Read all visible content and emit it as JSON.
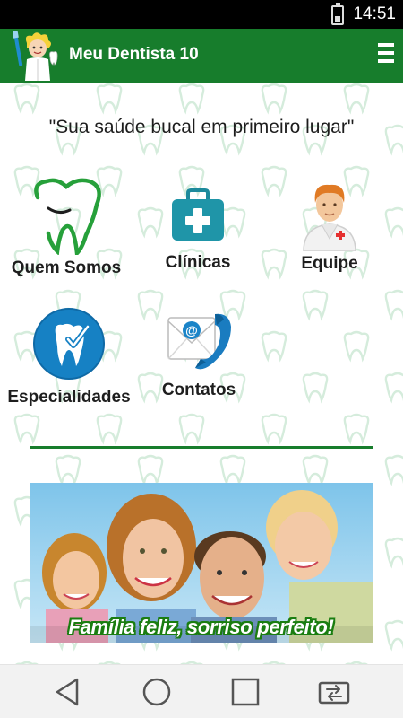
{
  "status": {
    "time": "14:51",
    "battery_icon": "battery-icon"
  },
  "app": {
    "title": "Meu Dentista 10",
    "color": "#177d2c"
  },
  "tagline": "\"Sua saúde bucal em primeiro lugar\"",
  "menu": [
    {
      "label": "Quem Somos",
      "icon": "tooth-outline-icon"
    },
    {
      "label": "Clínicas",
      "icon": "first-aid-kit-icon"
    },
    {
      "label": "Equipe",
      "icon": "doctor-icon"
    },
    {
      "label": "Especialidades",
      "icon": "tooth-check-icon"
    },
    {
      "label": "Contatos",
      "icon": "email-phone-icon"
    }
  ],
  "banner": {
    "caption": "Família feliz, sorriso perfeito!"
  },
  "nav": [
    "back-icon",
    "home-icon",
    "recents-icon",
    "switch-app-icon"
  ]
}
